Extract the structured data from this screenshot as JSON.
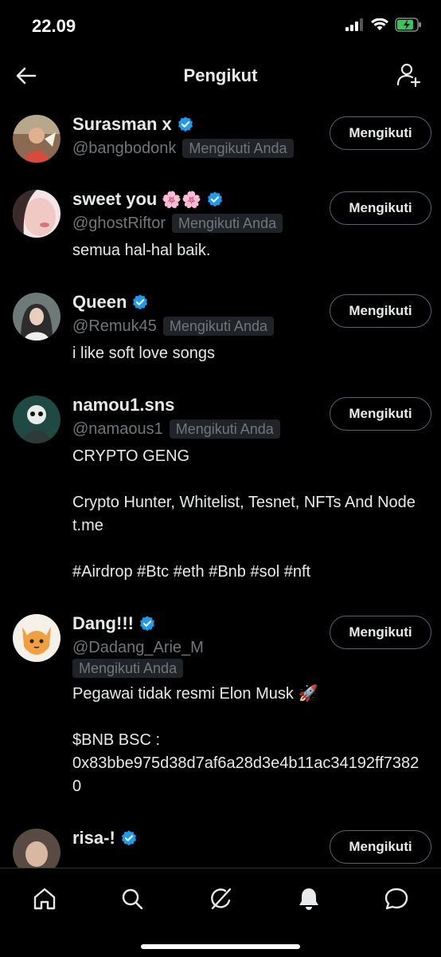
{
  "status_bar": {
    "time": "22.09"
  },
  "header": {
    "title": "Pengikut"
  },
  "followers": [
    {
      "name": "Surasman x",
      "verified": true,
      "emoji": "",
      "handle": "@bangbodonk",
      "follows_you": "Mengikuti Anda",
      "bio": "",
      "button": "Mengikuti"
    },
    {
      "name": "sweet you",
      "verified": true,
      "emoji": "🌸🌸",
      "handle": "@ghostRiftor",
      "follows_you": "Mengikuti Anda",
      "bio": "semua hal-hal baik.",
      "button": "Mengikuti"
    },
    {
      "name": "Queen",
      "verified": true,
      "emoji": "",
      "handle": "@Remuk45",
      "follows_you": "Mengikuti Anda",
      "bio": "i like soft love songs",
      "button": "Mengikuti"
    },
    {
      "name": "namou1.sns",
      "verified": false,
      "emoji": "",
      "handle": "@namaous1",
      "follows_you": "Mengikuti Anda",
      "bio": "CRYPTO GENG\n\nCrypto Hunter, Whitelist, Tesnet, NFTs And Node\nt.me\n\n#Airdrop #Btc #eth #Bnb #sol #nft",
      "button": "Mengikuti"
    },
    {
      "name": "Dang!!!",
      "verified": true,
      "emoji": "",
      "handle": "@Dadang_Arie_M",
      "follows_you": "Mengikuti Anda",
      "bio": "Pegawai tidak resmi Elon Musk 🚀\n\n$BNB BSC :\n0x83bbe975d38d7af6a28d3e4b11ac34192ff73820",
      "button": "Mengikuti"
    },
    {
      "name": "risa-!",
      "verified": true,
      "emoji": "",
      "handle": "",
      "follows_you": "",
      "bio": "",
      "button": "Mengikuti"
    }
  ],
  "icons": {
    "back": "arrow-left-icon",
    "add_user": "person-add-icon",
    "verified": "verified-badge-icon",
    "tabs": [
      "home-icon",
      "search-icon",
      "grok-icon",
      "bell-icon",
      "messages-icon"
    ]
  },
  "colors": {
    "background": "#000000",
    "verified": "#1d9bf0",
    "muted": "#71767b",
    "badge_bg": "#202327"
  }
}
